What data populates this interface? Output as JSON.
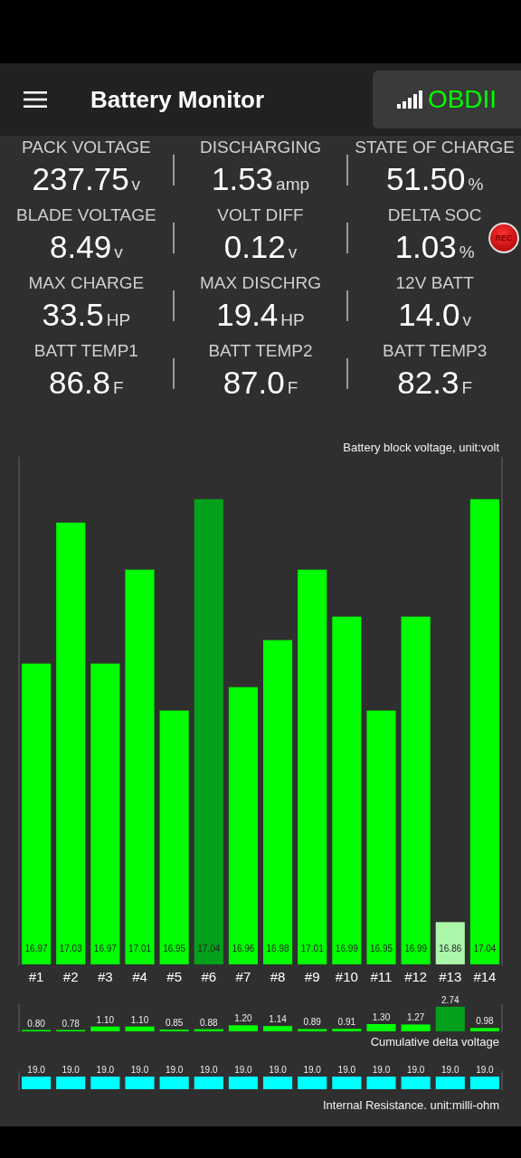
{
  "app_bar": {
    "title": "Battery Monitor",
    "connection_button": {
      "label": "OBDII"
    }
  },
  "metrics": [
    {
      "label": "PACK VOLTAGE",
      "value": "237.75",
      "unit": "v"
    },
    {
      "label": "DISCHARGING",
      "value": "1.53",
      "unit": "amp"
    },
    {
      "label": "STATE OF CHARGE",
      "value": "51.50",
      "unit": "%"
    },
    {
      "label": "BLADE VOLTAGE",
      "value": "8.49",
      "unit": "v"
    },
    {
      "label": "VOLT DIFF",
      "value": "0.12",
      "unit": "v"
    },
    {
      "label": "DELTA SOC",
      "value": "1.03",
      "unit": "%"
    },
    {
      "label": "MAX CHARGE",
      "value": "33.5",
      "unit": "HP"
    },
    {
      "label": "MAX DISCHRG",
      "value": "19.4",
      "unit": "HP"
    },
    {
      "label": "12V BATT",
      "value": "14.0",
      "unit": "v"
    },
    {
      "label": "BATT TEMP1",
      "value": "86.8",
      "unit": "F"
    },
    {
      "label": "BATT TEMP2",
      "value": "87.0",
      "unit": "F"
    },
    {
      "label": "BATT TEMP3",
      "value": "82.3",
      "unit": "F"
    }
  ],
  "rec_button": {
    "label": "REC"
  },
  "charts": [
    {
      "chart_data": {
        "type": "bar",
        "title": "Battery block voltage, unit:volt",
        "categories": [
          "#1",
          "#2",
          "#3",
          "#4",
          "#5",
          "#6",
          "#7",
          "#8",
          "#9",
          "#10",
          "#11",
          "#12",
          "#13",
          "#14"
        ],
        "ylim": [
          16.842,
          17.058
        ],
        "data_labels": true,
        "series": [
          {
            "color": "#00ff00",
            "values": [
              16.97,
              17.03,
              16.97,
              17.01,
              16.95,
              null,
              16.96,
              16.98,
              17.01,
              16.99,
              16.95,
              16.99,
              null,
              17.04
            ],
            "value_labels": [
              "16.97",
              "17.03",
              "16.97",
              "17.01",
              "16.95",
              null,
              "16.96",
              "16.98",
              "17.01",
              "16.99",
              "16.95",
              "16.99",
              null,
              "17.04"
            ]
          },
          {
            "color": "#03a11b",
            "values": [
              null,
              null,
              null,
              null,
              null,
              17.04,
              null,
              null,
              null,
              null,
              null,
              null,
              null,
              null
            ],
            "value_labels": [
              null,
              null,
              null,
              null,
              null,
              "17.04",
              null,
              null,
              null,
              null,
              null,
              null,
              null,
              null
            ]
          },
          {
            "color": "#aaf7aa",
            "values": [
              null,
              null,
              null,
              null,
              null,
              null,
              null,
              null,
              null,
              null,
              null,
              null,
              16.86,
              null
            ],
            "value_labels": [
              null,
              null,
              null,
              null,
              null,
              null,
              null,
              null,
              null,
              null,
              null,
              null,
              "16.86",
              null
            ]
          }
        ]
      }
    },
    {
      "chart_data": {
        "type": "bar",
        "title": "Cumulative delta voltage",
        "ylim": [
          0.7,
          2.8
        ],
        "data_labels": true,
        "series": [
          {
            "color": "#00ff00",
            "values": [
              0.8,
              0.78,
              1.1,
              1.1,
              0.85,
              0.88,
              1.2,
              1.14,
              0.89,
              0.91,
              1.3,
              1.27,
              null,
              0.98
            ],
            "value_labels": [
              "0.80",
              "0.78",
              "1.10",
              "1.10",
              "0.85",
              "0.88",
              "1.20",
              "1.14",
              "0.89",
              "0.91",
              "1.30",
              "1.27",
              null,
              "0.98"
            ]
          },
          {
            "color": "#03a11b",
            "values": [
              null,
              null,
              null,
              null,
              null,
              null,
              null,
              null,
              null,
              null,
              null,
              null,
              2.74,
              null
            ],
            "value_labels": [
              null,
              null,
              null,
              null,
              null,
              null,
              null,
              null,
              null,
              null,
              null,
              null,
              "2.74",
              null
            ]
          }
        ]
      }
    },
    {
      "chart_data": {
        "type": "bar",
        "title": "Internal Resistance. unit:milli-ohm",
        "data_labels": true,
        "series": [
          {
            "color": "#00ffff",
            "values": [
              19.0,
              19.0,
              19.0,
              19.0,
              19.0,
              19.0,
              19.0,
              19.0,
              19.0,
              19.0,
              19.0,
              19.0,
              19.0,
              19.0
            ],
            "value_labels": [
              "19.0",
              "19.0",
              "19.0",
              "19.0",
              "19.0",
              "19.0",
              "19.0",
              "19.0",
              "19.0",
              "19.0",
              "19.0",
              "19.0",
              "19.0",
              "19.0"
            ]
          }
        ]
      }
    }
  ]
}
